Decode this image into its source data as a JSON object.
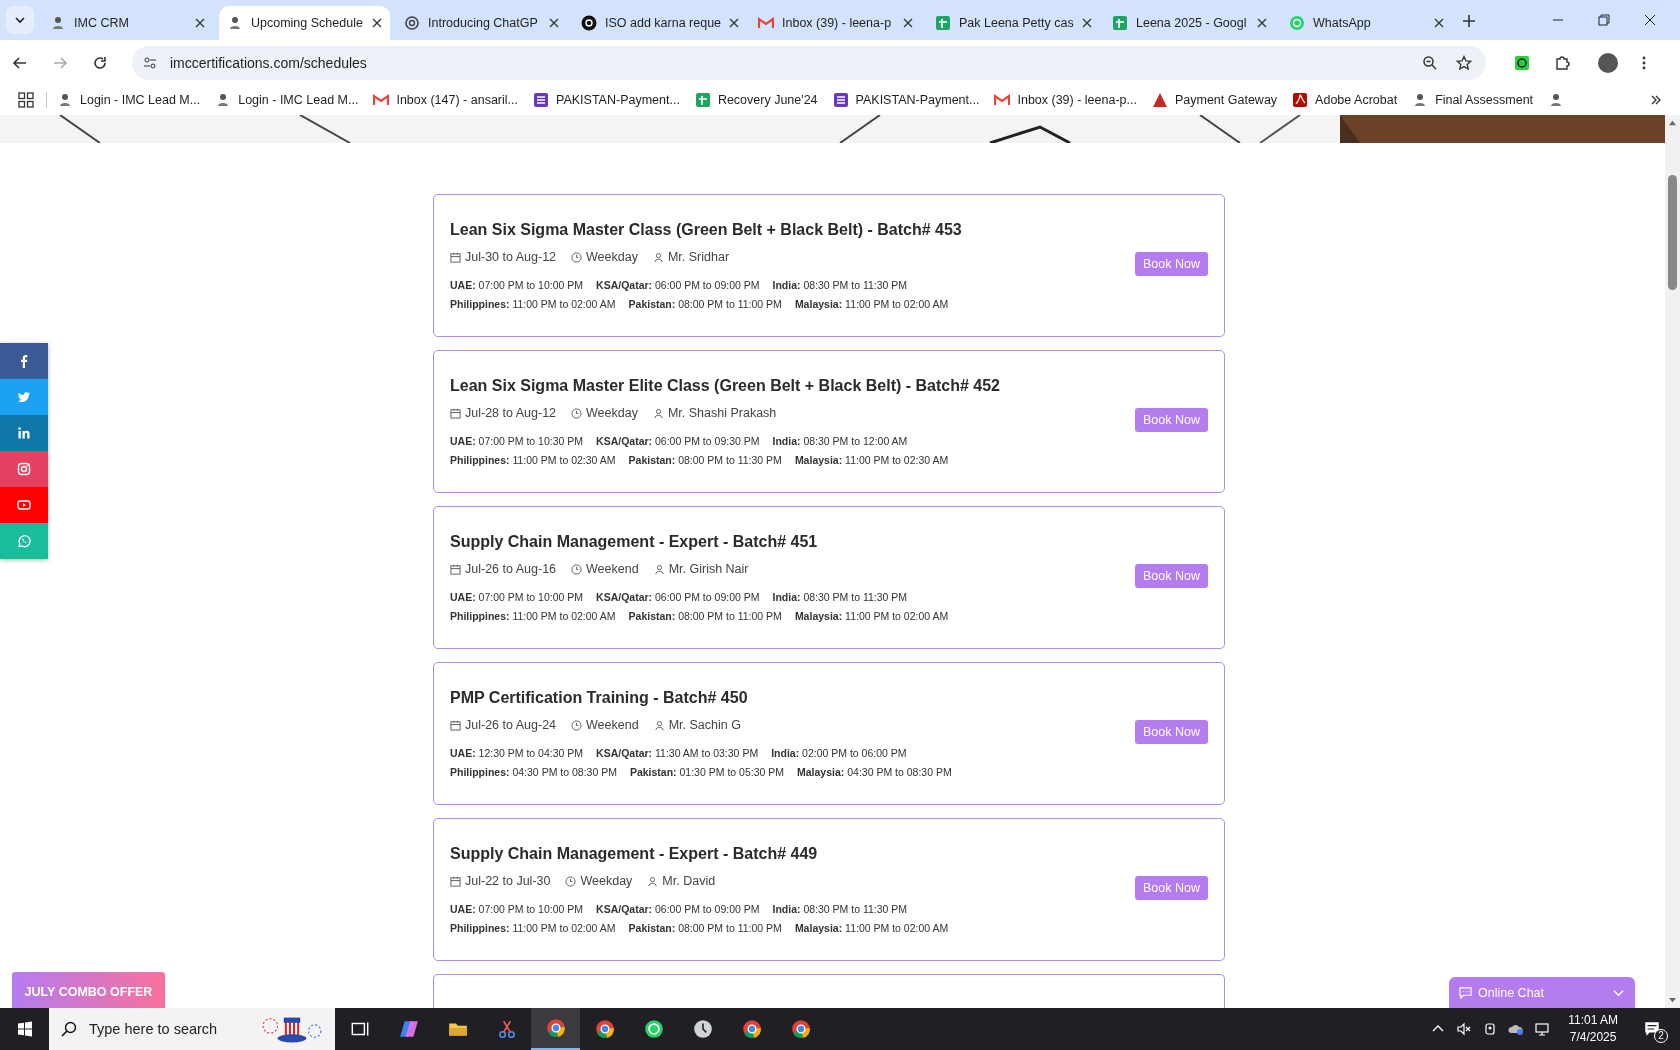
{
  "browser": {
    "tabs": [
      {
        "title": "IMC CRM",
        "kind": "mascot",
        "selected": false
      },
      {
        "title": "Upcoming Schedule",
        "kind": "mascot",
        "selected": true
      },
      {
        "title": "Introducing ChatGP",
        "kind": "swirl",
        "selected": false
      },
      {
        "title": "ISO add karna reque",
        "kind": "swirl-dark",
        "selected": false
      },
      {
        "title": "Inbox (39) - leena-p",
        "kind": "mail",
        "selected": false
      },
      {
        "title": "Pak Leena Petty cas",
        "kind": "sheet",
        "selected": false
      },
      {
        "title": "Leena 2025 - Googl",
        "kind": "sheet",
        "selected": false
      },
      {
        "title": "WhatsApp",
        "kind": "chat",
        "selected": false
      }
    ],
    "address": "imccertifications.com/schedules",
    "bookmarks": [
      {
        "label": "Login - IMC Lead M...",
        "kind": "mascot"
      },
      {
        "label": "Login - IMC Lead M...",
        "kind": "mascot"
      },
      {
        "label": "Inbox (147) - ansaril...",
        "kind": "mail"
      },
      {
        "label": "PAKISTAN-Payment...",
        "kind": "form"
      },
      {
        "label": "Recovery June'24",
        "kind": "sheet"
      },
      {
        "label": "PAKISTAN-Payment...",
        "kind": "form"
      },
      {
        "label": "Inbox (39) - leena-p...",
        "kind": "mail"
      },
      {
        "label": "Payment Gateway",
        "kind": "triangle"
      },
      {
        "label": "Adobe Acrobat",
        "kind": "pdf"
      },
      {
        "label": "Final Assessment",
        "kind": "mascot"
      },
      {
        "kind": "mascot"
      }
    ]
  },
  "page": {
    "social": [
      {
        "kind": "facebook",
        "color": "#3b5998"
      },
      {
        "kind": "twitter",
        "color": "#1da1f2"
      },
      {
        "kind": "linkedin",
        "color": "#0e76a8"
      },
      {
        "kind": "instagram",
        "color": "#e4405f"
      },
      {
        "kind": "youtube",
        "color": "#ff0000"
      },
      {
        "kind": "whatsapp",
        "color": "#1abc9c"
      }
    ],
    "schedules": [
      {
        "title": "Lean Six Sigma Master Class (Green Belt + Black Belt) - Batch# 453",
        "dates": "Jul-30 to Aug-12",
        "mode": "Weekday",
        "trainer": "Mr. Sridhar",
        "button": "Book Now",
        "timings": [
          [
            {
              "zone": "UAE:",
              "time": "07:00 PM to 10:00 PM"
            },
            {
              "zone": "KSA/Qatar:",
              "time": "06:00 PM to 09:00 PM"
            },
            {
              "zone": "India:",
              "time": "08:30 PM to 11:30 PM"
            }
          ],
          [
            {
              "zone": "Philippines:",
              "time": "11:00 PM to 02:00 AM"
            },
            {
              "zone": "Pakistan:",
              "time": "08:00 PM to 11:00 PM"
            },
            {
              "zone": "Malaysia:",
              "time": "11:00 PM to 02:00 AM"
            }
          ]
        ]
      },
      {
        "title": "Lean Six Sigma Master Elite Class (Green Belt + Black Belt) - Batch# 452",
        "dates": "Jul-28 to Aug-12",
        "mode": "Weekday",
        "trainer": "Mr. Shashi Prakash",
        "button": "Book Now",
        "timings": [
          [
            {
              "zone": "UAE:",
              "time": "07:00 PM to 10:30 PM"
            },
            {
              "zone": "KSA/Qatar:",
              "time": "06:00 PM to 09:30 PM"
            },
            {
              "zone": "India:",
              "time": "08:30 PM to 12:00 AM"
            }
          ],
          [
            {
              "zone": "Philippines:",
              "time": "11:00 PM to 02:30 AM"
            },
            {
              "zone": "Pakistan:",
              "time": "08:00 PM to 11:30 PM"
            },
            {
              "zone": "Malaysia:",
              "time": "11:00 PM to 02:30 AM"
            }
          ]
        ]
      },
      {
        "title": "Supply Chain Management - Expert - Batch# 451",
        "dates": "Jul-26 to Aug-16",
        "mode": "Weekend",
        "trainer": "Mr. Girish Nair",
        "button": "Book Now",
        "timings": [
          [
            {
              "zone": "UAE:",
              "time": "07:00 PM to 10:00 PM"
            },
            {
              "zone": "KSA/Qatar:",
              "time": "06:00 PM to 09:00 PM"
            },
            {
              "zone": "India:",
              "time": "08:30 PM to 11:30 PM"
            }
          ],
          [
            {
              "zone": "Philippines:",
              "time": "11:00 PM to 02:00 AM"
            },
            {
              "zone": "Pakistan:",
              "time": "08:00 PM to 11:00 PM"
            },
            {
              "zone": "Malaysia:",
              "time": "11:00 PM to 02:00 AM"
            }
          ]
        ]
      },
      {
        "title": "PMP Certification Training - Batch# 450",
        "dates": "Jul-26 to Aug-24",
        "mode": "Weekend",
        "trainer": "Mr. Sachin G",
        "button": "Book Now",
        "timings": [
          [
            {
              "zone": "UAE:",
              "time": "12:30 PM to 04:30 PM"
            },
            {
              "zone": "KSA/Qatar:",
              "time": "11:30 AM to 03:30 PM"
            },
            {
              "zone": "India:",
              "time": "02:00 PM to 06:00 PM"
            }
          ],
          [
            {
              "zone": "Philippines:",
              "time": "04:30 PM to 08:30 PM"
            },
            {
              "zone": "Pakistan:",
              "time": "01:30 PM to 05:30 PM"
            },
            {
              "zone": "Malaysia:",
              "time": "04:30 PM to 08:30 PM"
            }
          ]
        ]
      },
      {
        "title": "Supply Chain Management - Expert - Batch# 449",
        "dates": "Jul-22 to Jul-30",
        "mode": "Weekday",
        "trainer": "Mr. David",
        "button": "Book Now",
        "timings": [
          [
            {
              "zone": "UAE:",
              "time": "07:00 PM to 10:00 PM"
            },
            {
              "zone": "KSA/Qatar:",
              "time": "06:00 PM to 09:00 PM"
            },
            {
              "zone": "India:",
              "time": "08:30 PM to 11:30 PM"
            }
          ],
          [
            {
              "zone": "Philippines:",
              "time": "11:00 PM to 02:00 AM"
            },
            {
              "zone": "Pakistan:",
              "time": "08:00 PM to 11:00 PM"
            },
            {
              "zone": "Malaysia:",
              "time": "11:00 PM to 02:00 AM"
            }
          ]
        ]
      }
    ],
    "offer_button": "JULY COMBO OFFER",
    "chat_widget": "Online Chat"
  },
  "taskbar": {
    "search_placeholder": "Type here to search",
    "apps": [
      {
        "kind": "task-view",
        "selected": false
      },
      {
        "kind": "copilot",
        "selected": false
      },
      {
        "kind": "folder",
        "selected": false
      },
      {
        "kind": "scissors",
        "selected": false
      },
      {
        "kind": "chrome",
        "selected": true
      },
      {
        "kind": "chrome",
        "selected": false
      },
      {
        "kind": "whatsapp",
        "selected": false
      },
      {
        "kind": "clock",
        "selected": false
      },
      {
        "kind": "chrome",
        "selected": false
      },
      {
        "kind": "chrome",
        "selected": false
      }
    ],
    "time": "11:01 AM",
    "date": "7/4/2025",
    "notifications": "2"
  }
}
